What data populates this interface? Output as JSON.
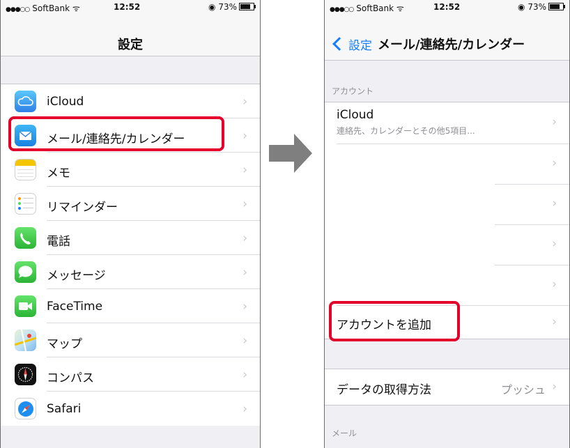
{
  "left": {
    "status": {
      "carrier": "SoftBank",
      "time": "12:52",
      "battery": "73%"
    },
    "title": "設定",
    "items": [
      {
        "label": "iCloud",
        "icon": "icloud-icon"
      },
      {
        "label": "メール/連絡先/カレンダー",
        "icon": "mail-icon",
        "highlighted": true
      },
      {
        "label": "メモ",
        "icon": "notes-icon"
      },
      {
        "label": "リマインダー",
        "icon": "reminders-icon"
      },
      {
        "label": "電話",
        "icon": "phone-icon"
      },
      {
        "label": "メッセージ",
        "icon": "messages-icon"
      },
      {
        "label": "FaceTime",
        "icon": "facetime-icon"
      },
      {
        "label": "マップ",
        "icon": "maps-icon"
      },
      {
        "label": "コンパス",
        "icon": "compass-icon"
      },
      {
        "label": "Safari",
        "icon": "safari-icon"
      }
    ]
  },
  "right": {
    "status": {
      "carrier": "SoftBank",
      "time": "12:52",
      "battery": "73%"
    },
    "back_label": "設定",
    "title": "メール/連絡先/カレンダー",
    "accounts_header": "アカウント",
    "icloud": {
      "label": "iCloud",
      "detail": "連絡先、カレンダーとその他5項目..."
    },
    "add_account": "アカウントを追加",
    "fetch": {
      "label": "データの取得方法",
      "value": "プッシュ"
    },
    "mail_header": "メール"
  },
  "colors": {
    "highlight": "#e4002b",
    "accent": "#157efb",
    "arrow": "#7f7f7f"
  }
}
